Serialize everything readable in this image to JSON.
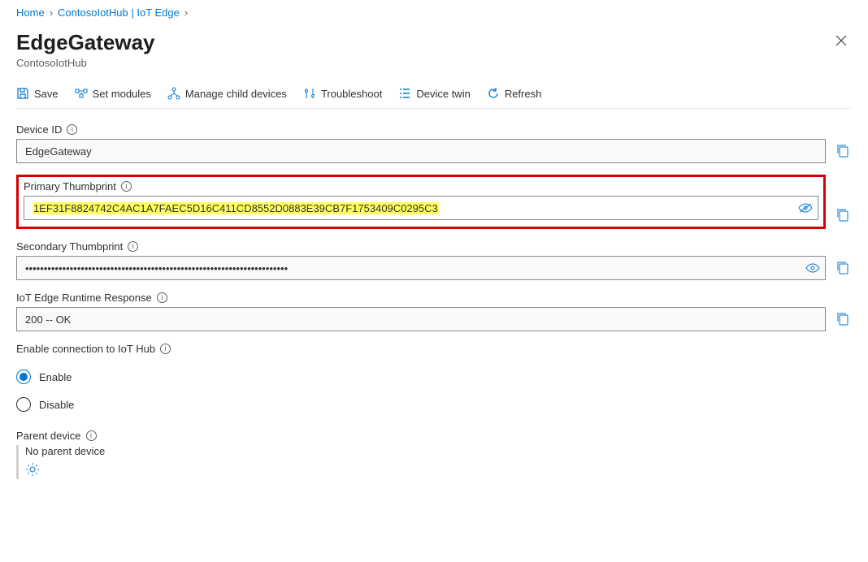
{
  "breadcrumb": {
    "home": "Home",
    "hub": "ContosoIotHub | IoT Edge"
  },
  "header": {
    "title": "EdgeGateway",
    "subtitle": "ContosoIotHub"
  },
  "toolbar": {
    "save": "Save",
    "set_modules": "Set modules",
    "manage_child": "Manage child devices",
    "troubleshoot": "Troubleshoot",
    "device_twin": "Device twin",
    "refresh": "Refresh"
  },
  "fields": {
    "device_id_label": "Device ID",
    "device_id_value": "EdgeGateway",
    "primary_thumb_label": "Primary Thumbprint",
    "primary_thumb_value": "1EF31F8824742C4AC1A7FAEC5D16C411CD8552D0883E39CB7F1753409C0295C3",
    "secondary_thumb_label": "Secondary Thumbprint",
    "secondary_thumb_value": "•••••••••••••••••••••••••••••••••••••••••••••••••••••••••••••••••••••••",
    "runtime_label": "IoT Edge Runtime Response",
    "runtime_value": "200 -- OK",
    "enable_conn_label": "Enable connection to IoT Hub",
    "enable_option": "Enable",
    "disable_option": "Disable",
    "parent_label": "Parent device",
    "parent_value": "No parent device"
  }
}
